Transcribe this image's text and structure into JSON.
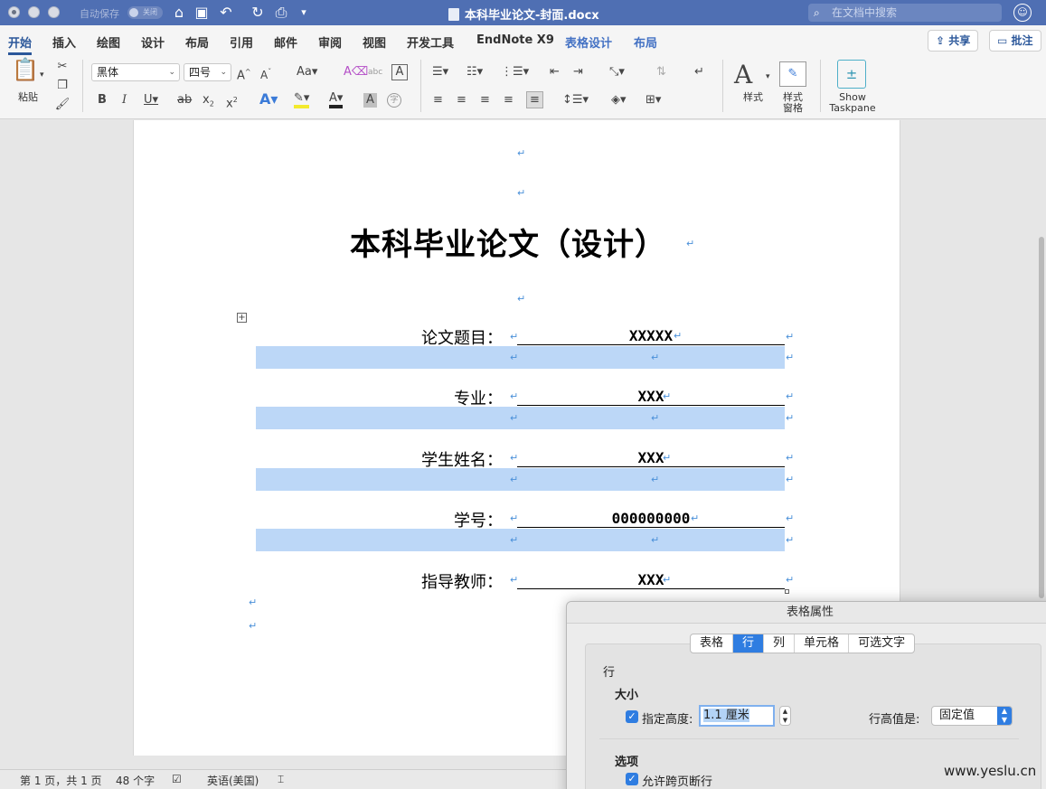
{
  "titlebar": {
    "autosave_label": "自动保存",
    "autosave_state": "关闭",
    "doc_title": "本科毕业论文-封面.docx",
    "search_placeholder": "在文档中搜索"
  },
  "menu": {
    "tabs": [
      "开始",
      "插入",
      "绘图",
      "设计",
      "布局",
      "引用",
      "邮件",
      "审阅",
      "视图",
      "开发工具",
      "EndNote X9",
      "表格设计",
      "布局"
    ],
    "share": "共享",
    "comment": "批注"
  },
  "ribbon": {
    "paste": "粘贴",
    "font_name": "黑体",
    "font_size": "四号",
    "styles": "样式",
    "styles_pane": "样式\n窗格",
    "styles_pane_l1": "样式",
    "styles_pane_l2": "窗格",
    "show_taskpane_l1": "Show",
    "show_taskpane_l2": "Taskpane"
  },
  "document": {
    "title": "本科毕业论文（设计）",
    "rows": [
      {
        "label": "论文题目：",
        "value": "XXXXX"
      },
      {
        "label": "专业：",
        "value": "XXX"
      },
      {
        "label": "学生姓名：",
        "value": "XXX"
      },
      {
        "label": "学号：",
        "value": "000000000"
      },
      {
        "label": "指导教师：",
        "value": "XXX"
      }
    ],
    "para_mark": "↵"
  },
  "status": {
    "page": "第 1 页，共 1 页",
    "words": "48 个字",
    "language": "英语(美国)"
  },
  "dialog": {
    "title": "表格属性",
    "tabs": [
      "表格",
      "行",
      "列",
      "单元格",
      "可选文字"
    ],
    "active_tab": "行",
    "section_row": "行",
    "size_heading": "大小",
    "height_label": "指定高度:",
    "height_value": "1.1 厘米",
    "row_height_is_label": "行高值是:",
    "row_height_is_value": "固定值",
    "options_heading": "选项",
    "allow_break": "允许跨页断行"
  },
  "watermark": "www.yeslu.cn",
  "colors": {
    "titlebar": "#4f6fb3",
    "accent": "#2b579a",
    "highlight": "#bcd7f7",
    "dialog_accent": "#2f7de1"
  }
}
